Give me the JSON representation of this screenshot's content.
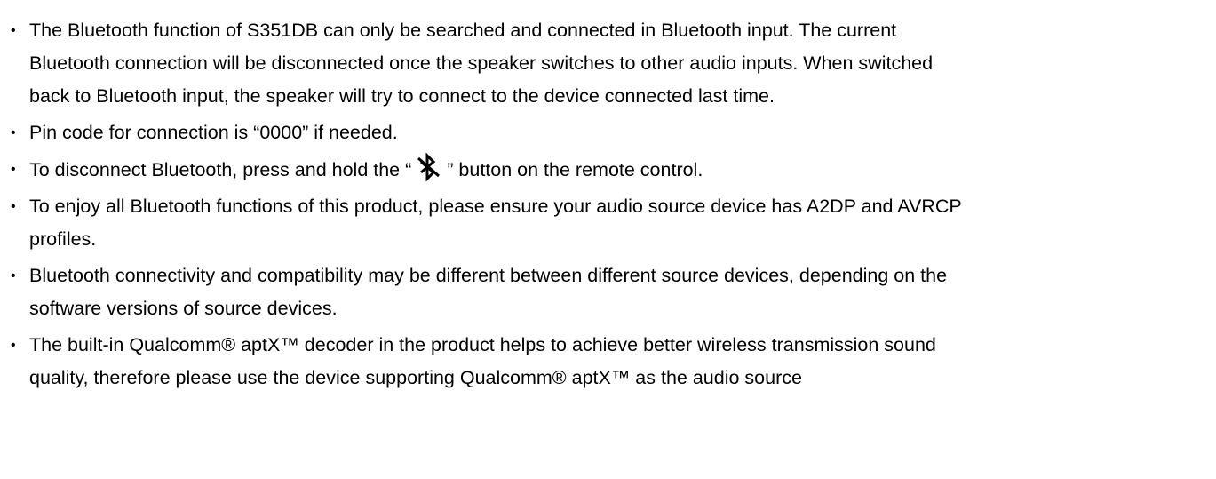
{
  "notes": [
    {
      "lines": [
        "The Bluetooth function of S351DB can only be searched and connected in Bluetooth input. The current",
        "Bluetooth connection will be disconnected once the speaker switches to other audio inputs. When switched",
        "back to Bluetooth input, the speaker will try to connect to the device connected last time."
      ]
    },
    {
      "lines": [
        "Pin code for connection is “0000” if needed."
      ]
    },
    {
      "before_icon": "To disconnect Bluetooth, press and hold the “",
      "icon": "bluetooth-disconnect-icon",
      "after_icon": "” button on the remote control."
    },
    {
      "lines": [
        "To enjoy all Bluetooth functions of this product, please ensure your audio source device has A2DP and AVRCP",
        "profiles."
      ]
    },
    {
      "lines": [
        "Bluetooth connectivity and compatibility may be different between different source devices, depending on the",
        "software versions of source devices."
      ]
    },
    {
      "lines": [
        "The built-in Qualcomm® aptX™ decoder in the product helps to achieve better wireless transmission sound",
        "quality, therefore please use the device supporting Qualcomm® aptX™ as the audio  source"
      ]
    }
  ]
}
